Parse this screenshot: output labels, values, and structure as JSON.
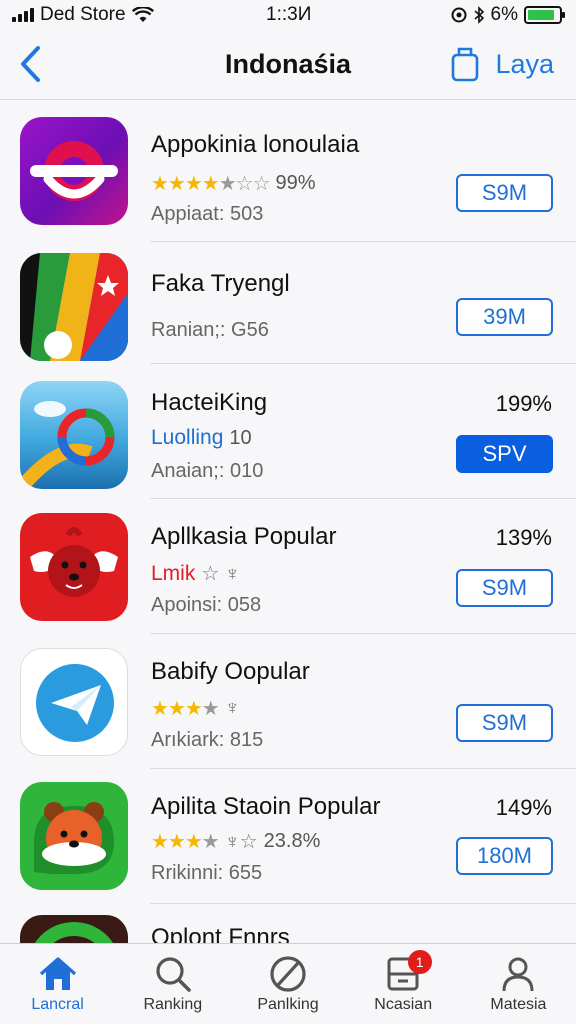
{
  "status_bar": {
    "carrier": "Ded Store",
    "time": "1::3И",
    "battery": "6%",
    "battery_level": 0.85
  },
  "nav": {
    "title": "Indonaśia",
    "right_label": "Laya"
  },
  "apps": [
    {
      "name": "Appokinia lonoulaia",
      "rating_text": "99%",
      "sub": "Appiaat: 503",
      "action": "S9M",
      "filled": false,
      "percent": "",
      "rating_type": "stars",
      "stars_on": 5
    },
    {
      "name": "Faka Tryengl",
      "rating_text": "",
      "sub": "Ranian;: G56",
      "action": "39M",
      "filled": false,
      "percent": "",
      "rating_type": "none",
      "stars_on": 0
    },
    {
      "name": "HacteiKing",
      "rating_text": "10",
      "rating_label": "Luolling",
      "sub": "Anaian;: 010",
      "action": "SPV",
      "filled": true,
      "percent": "199%",
      "rating_type": "link",
      "stars_on": 0
    },
    {
      "name": "Apllkasia Popular",
      "rating_label": "Lmik",
      "rating_text": "",
      "sub": "Apoinsi: 058",
      "action": "S9M",
      "filled": false,
      "percent": "139%",
      "rating_type": "red",
      "stars_on": 0
    },
    {
      "name": "Babify Oopular",
      "rating_text": "",
      "sub": "Arıkiark: 815",
      "action": "S9M",
      "filled": false,
      "percent": "",
      "rating_type": "stars",
      "stars_on": 4
    },
    {
      "name": "Apilita Staoin Popular",
      "rating_text": "23.8%",
      "sub": "Rrikinni: 655",
      "action": "180M",
      "filled": false,
      "percent": "149%",
      "rating_type": "stars",
      "stars_on": 4
    },
    {
      "name": "Oplont Fnnrs",
      "rating_text": "",
      "sub": "",
      "action": "",
      "filled": false,
      "percent": "",
      "rating_type": "none",
      "stars_on": 0
    }
  ],
  "tabs": [
    {
      "label": "Lancral",
      "icon": "home-icon"
    },
    {
      "label": "Ranking",
      "icon": "search-icon"
    },
    {
      "label": "Panlking",
      "icon": "no-entry-icon"
    },
    {
      "label": "Ncasian",
      "icon": "updates-icon",
      "badge": "1"
    },
    {
      "label": "Matesia",
      "icon": "person-icon"
    }
  ],
  "colors": {
    "accent": "#1f6fd6",
    "star": "#f5b800",
    "badge": "#e21b1b",
    "battery": "#2ec24b"
  }
}
